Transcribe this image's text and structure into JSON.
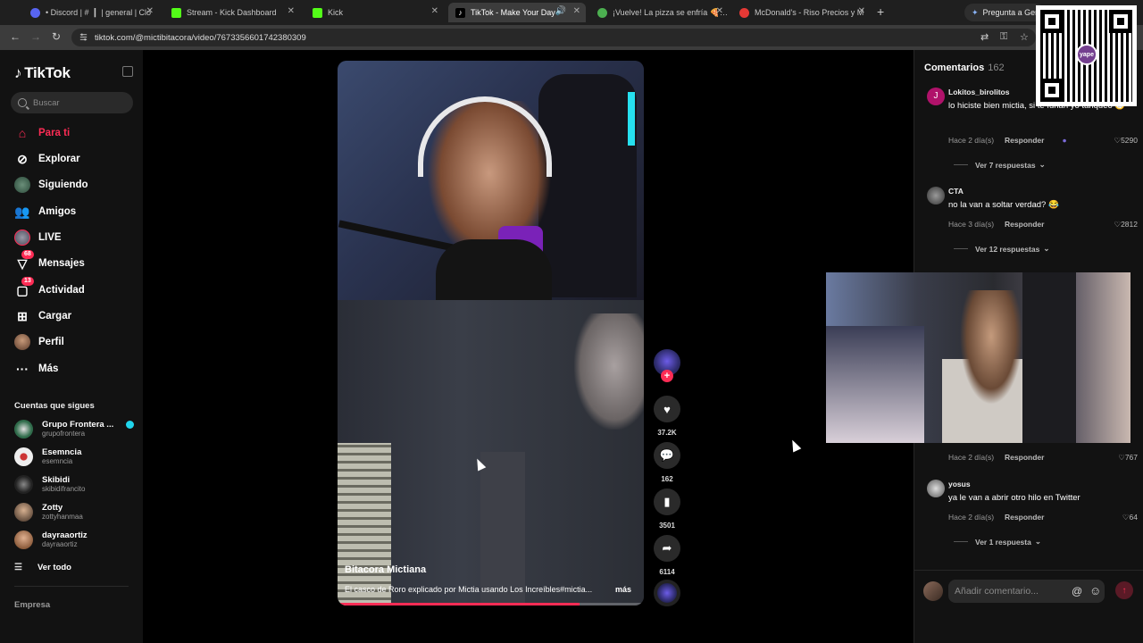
{
  "browser": {
    "tabs": [
      {
        "title": "• Discord | #▕▏| general | Clo",
        "fav_color": "#5865f2",
        "active": false
      },
      {
        "title": "Stream - Kick Dashboard",
        "fav_color": "#53fc18",
        "active": false
      },
      {
        "title": "Kick",
        "fav_color": "#53fc18",
        "active": false
      },
      {
        "title": "TikTok - Make Your Day",
        "fav_color": "#ffffff",
        "active": true
      },
      {
        "title": "¡Vuelve! La pizza se enfría 🍕🟦",
        "fav_color": "#4caf50",
        "active": false
      },
      {
        "title": "McDonald's - Riso Precios y M",
        "fav_color": "#e53935",
        "active": false
      }
    ],
    "new_tab": "+",
    "gemini_label": "Pregunta a Gemini",
    "url": "tiktok.com/@mictibitacora/video/7673356601742380309"
  },
  "sidebar": {
    "logo": "TikTok",
    "search_placeholder": "Buscar",
    "nav": [
      {
        "label": "Para ti",
        "icon": "home-icon",
        "active": true,
        "badge": ""
      },
      {
        "label": "Explorar",
        "icon": "compass-icon",
        "active": false,
        "badge": ""
      },
      {
        "label": "Siguiendo",
        "icon": "following-avatar-icon",
        "active": false,
        "badge": ""
      },
      {
        "label": "Amigos",
        "icon": "friends-icon",
        "active": false,
        "badge": ""
      },
      {
        "label": "LIVE",
        "icon": "live-icon",
        "active": false,
        "badge": ""
      },
      {
        "label": "Mensajes",
        "icon": "messages-icon",
        "active": false,
        "badge": "68"
      },
      {
        "label": "Actividad",
        "icon": "activity-icon",
        "active": false,
        "badge": "13"
      },
      {
        "label": "Cargar",
        "icon": "upload-icon",
        "active": false,
        "badge": ""
      },
      {
        "label": "Perfil",
        "icon": "profile-icon",
        "active": false,
        "badge": ""
      },
      {
        "label": "Más",
        "icon": "more-icon",
        "active": false,
        "badge": ""
      }
    ],
    "following_title": "Cuentas que sigues",
    "accounts": [
      {
        "name": "Grupo Frontera ...",
        "handle": "grupofrontera",
        "verified": true,
        "color": "#2f6b4a"
      },
      {
        "name": "Esemncia",
        "handle": "esemncia",
        "verified": false,
        "color": "#e8e8e8"
      },
      {
        "name": "Skibidi",
        "handle": "skibidifrancito",
        "verified": false,
        "color": "#1a1a1a"
      },
      {
        "name": "Zotty",
        "handle": "zottyhanmaa",
        "verified": false,
        "color": "#7a6b5a"
      },
      {
        "name": "dayraaortiz",
        "handle": "dayraaortiz",
        "verified": false,
        "color": "#8a5a3a"
      }
    ],
    "see_all": "Ver todo",
    "footer": "Empresa"
  },
  "video": {
    "author": "Bitacora Mictiana",
    "caption": "El casco de Roro explicado por Mictia usando Los Increíbles#mictia...",
    "more": "más",
    "progress": 0.79,
    "accent": "#fe2c55"
  },
  "actions": {
    "likes": "37.2K",
    "comments": "162",
    "saves": "3501",
    "shares": "6114"
  },
  "comments": {
    "title": "Comentarios",
    "count": "162",
    "reply_label": "Responder",
    "items": [
      {
        "user": "Lokitos_birolitos",
        "text": "lo hiciste bien mictia, si te funan yo tanqueo 😁",
        "time": "Hace 2 día(s)",
        "likes": "5290",
        "more": "Ver 7 respuestas",
        "av_color": "#b0126a"
      },
      {
        "user": "CTA",
        "text": "no la van a soltar verdad? 😂",
        "time": "Hace 3 día(s)",
        "likes": "2812",
        "more": "Ver 12 respuestas",
        "av_color": "#5a5a5a"
      },
      {
        "user": "",
        "text": "",
        "time": "Hace 2 día(s)",
        "likes": "767",
        "more": "",
        "av_color": "#333"
      },
      {
        "user": "yosus",
        "text": "ya le van a abrir otro hilo en Twitter",
        "time": "Hace 2 día(s)",
        "likes": "64",
        "more": "Ver 1 respuesta",
        "av_color": "#cfcfcf"
      }
    ],
    "input_placeholder": "Añadir comentario..."
  },
  "overlay": {
    "qr_brand": "yape"
  }
}
